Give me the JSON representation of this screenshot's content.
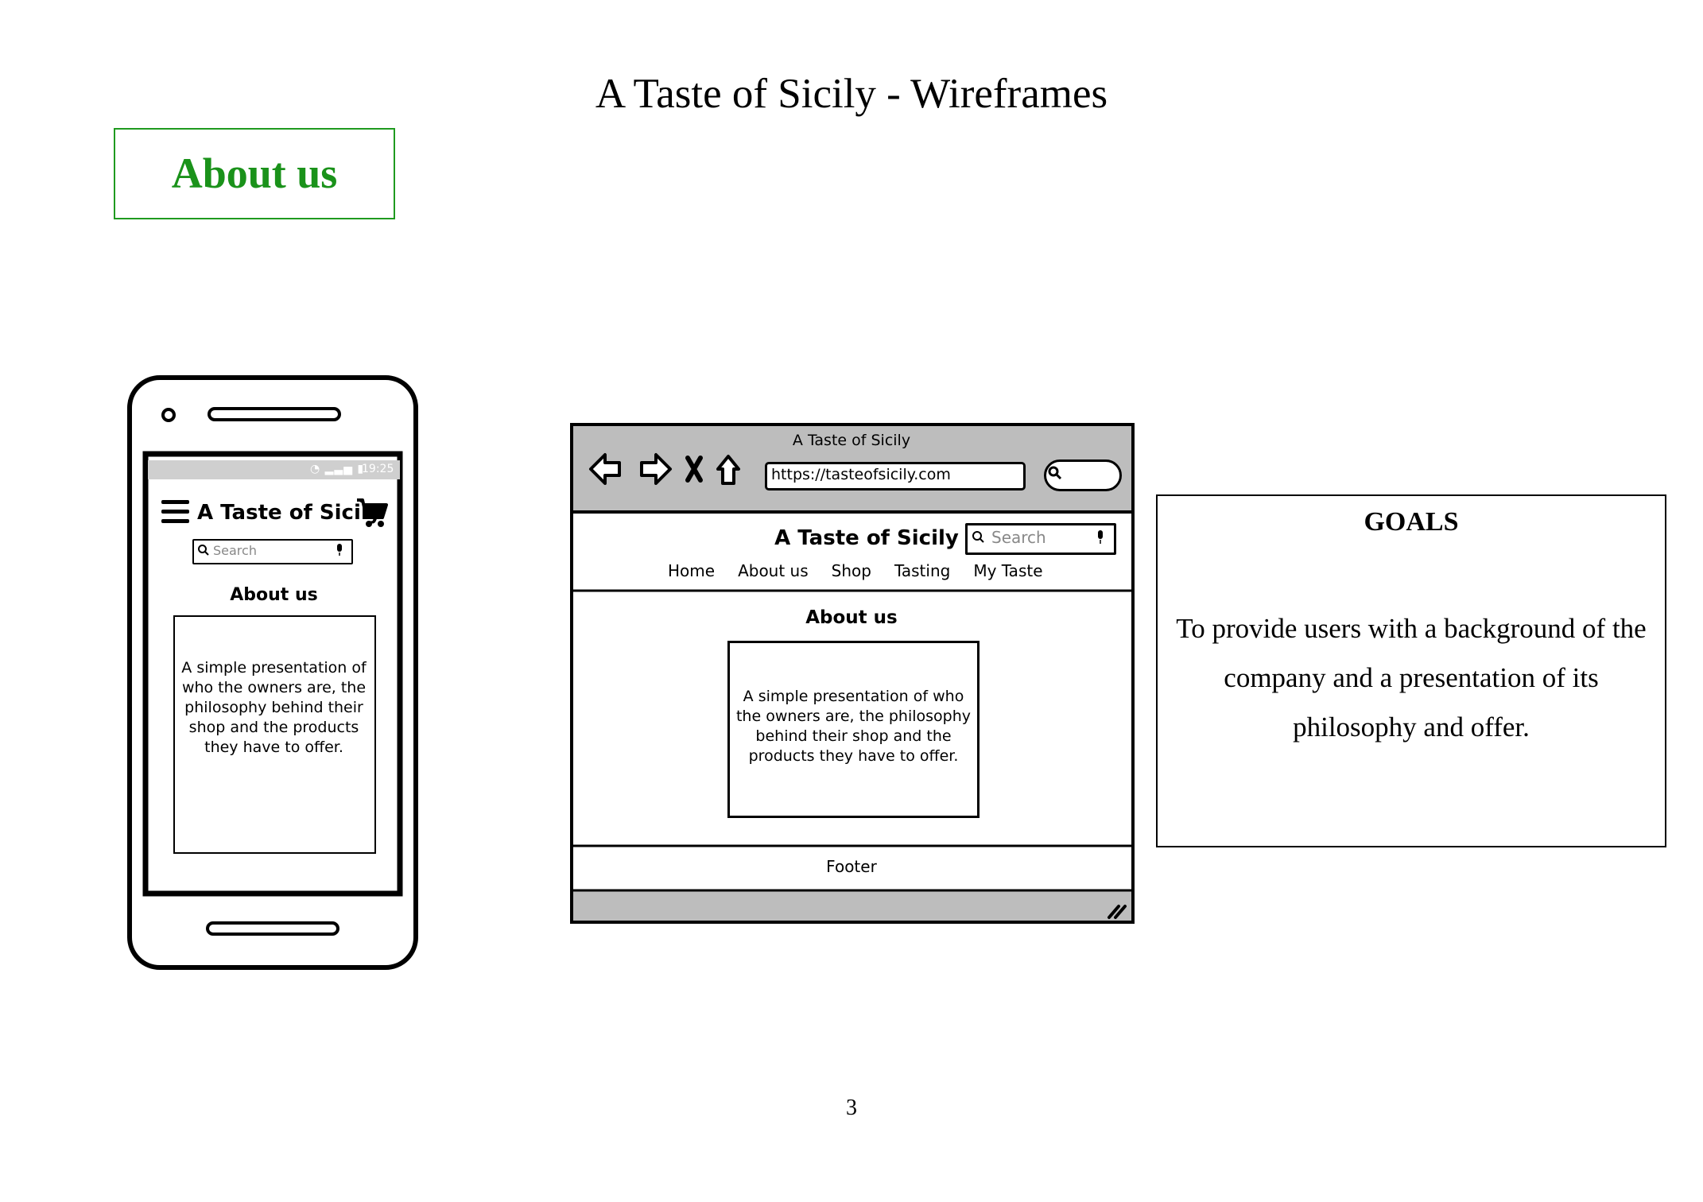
{
  "document": {
    "title": "A Taste of Sicily - Wireframes",
    "section_label": "About us",
    "page_number": "3"
  },
  "mobile": {
    "status_time": "19:25",
    "brand": "A Taste of Sicily",
    "search_placeholder": "Search",
    "heading": "About us",
    "description": "A simple presentation of who the owners are, the philosophy behind their shop and the products they have to offer.",
    "icons": [
      "menu-icon",
      "cart-icon",
      "search-icon",
      "mic-icon",
      "wifi-icon",
      "battery-icon"
    ]
  },
  "desktop": {
    "window_title": "A Taste of Sicily",
    "url": "https://tasteofsicily.com",
    "brand": "A Taste of Sicily",
    "search_placeholder": "Search",
    "nav": [
      "Home",
      "About us",
      "Shop",
      "Tasting",
      "My Taste"
    ],
    "heading": "About us",
    "description": "A simple presentation of who the owners are, the philosophy behind their shop and the products they have to offer.",
    "footer": "Footer",
    "icons": [
      "back-arrow-icon",
      "forward-arrow-icon",
      "close-icon",
      "home-icon",
      "search-icon",
      "mic-icon",
      "resize-grip-icon"
    ]
  },
  "goals": {
    "title": "GOALS",
    "text": "To provide users with a background of the company and a presentation of its philosophy and offer."
  },
  "colors": {
    "accent_green": "#1a921a",
    "chrome_gray": "#bdbdbd",
    "status_gray": "#cfcfcf"
  }
}
